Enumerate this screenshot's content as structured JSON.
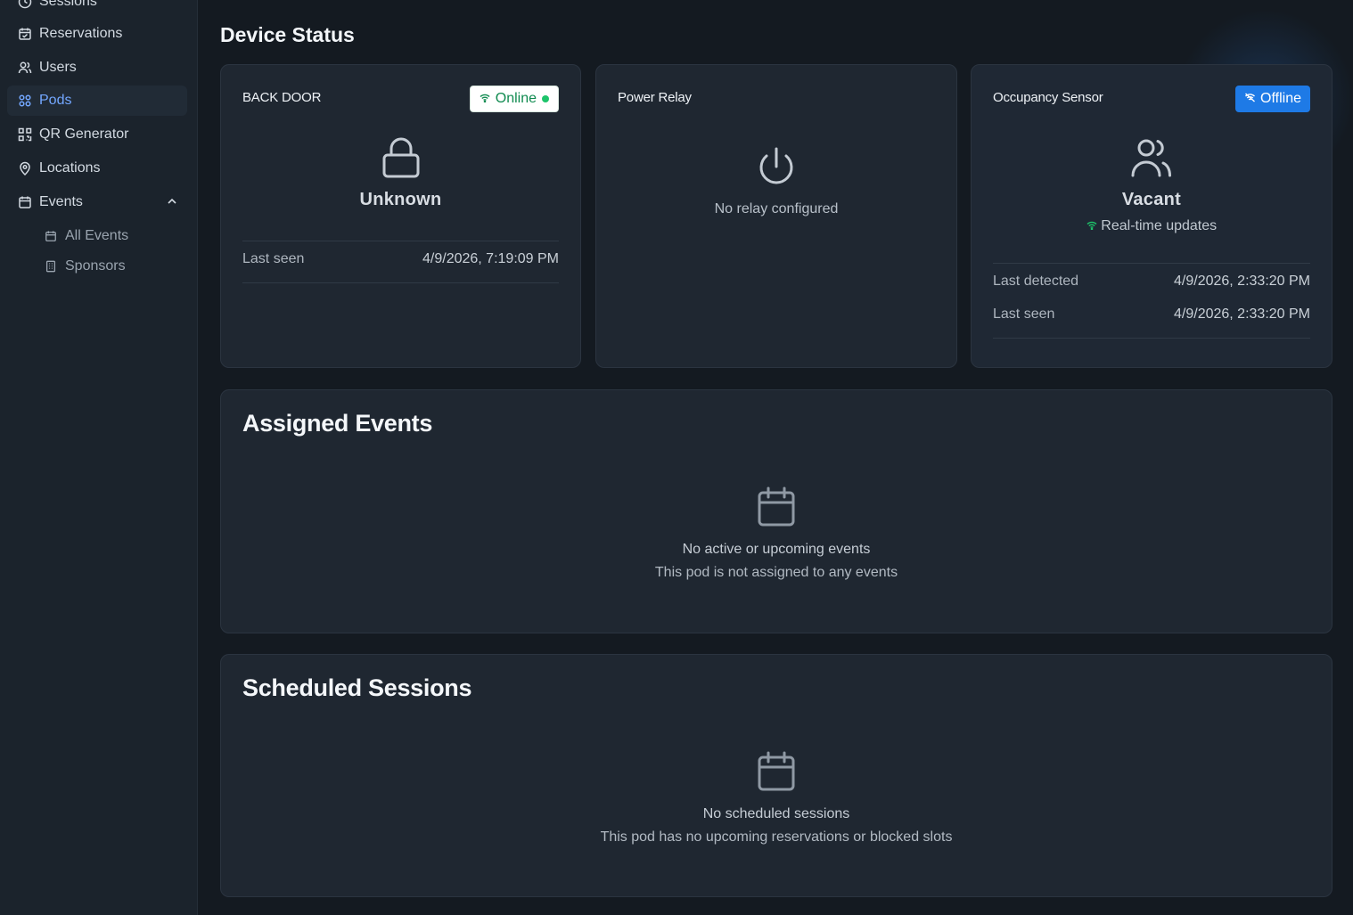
{
  "sidebar": {
    "items": [
      {
        "label": "Sessions",
        "icon": "clock-icon"
      },
      {
        "label": "Reservations",
        "icon": "calendar-check-icon"
      },
      {
        "label": "Users",
        "icon": "users-icon"
      },
      {
        "label": "Pods",
        "icon": "grid-icon",
        "active": true
      },
      {
        "label": "QR Generator",
        "icon": "qr-code-icon"
      },
      {
        "label": "Locations",
        "icon": "map-pin-icon"
      },
      {
        "label": "Events",
        "icon": "calendar-icon",
        "expanded": true
      }
    ],
    "sub_items": [
      {
        "label": "All Events",
        "icon": "calendar-icon"
      },
      {
        "label": "Sponsors",
        "icon": "building-icon"
      }
    ]
  },
  "page": {
    "title": "Device Status"
  },
  "devices": {
    "door": {
      "title": "BACK DOOR",
      "badge": "Online",
      "status": "Unknown",
      "last_seen_label": "Last seen",
      "last_seen_value": "4/9/2026, 7:19:09 PM",
      "icon": "lock-icon"
    },
    "relay": {
      "title": "Power Relay",
      "message": "No relay configured",
      "icon": "power-icon"
    },
    "occupancy": {
      "title": "Occupancy Sensor",
      "badge": "Offline",
      "status": "Vacant",
      "realtime": "Real-time updates",
      "last_detected_label": "Last detected",
      "last_detected_value": "4/9/2026, 2:33:20 PM",
      "last_seen_label": "Last seen",
      "last_seen_value": "4/9/2026, 2:33:20 PM",
      "icon": "users-icon"
    }
  },
  "assigned_events": {
    "title": "Assigned Events",
    "empty_title": "No active or upcoming events",
    "empty_subtitle": "This pod is not assigned to any events"
  },
  "scheduled_sessions": {
    "title": "Scheduled Sessions",
    "empty_title": "No scheduled sessions",
    "empty_subtitle": "This pod has no upcoming reservations or blocked slots"
  },
  "colors": {
    "accent": "#73a7ff",
    "online": "#1ec46b",
    "offline_badge": "#1e7ae6",
    "background": "#141a21",
    "card": "#1f2731"
  }
}
